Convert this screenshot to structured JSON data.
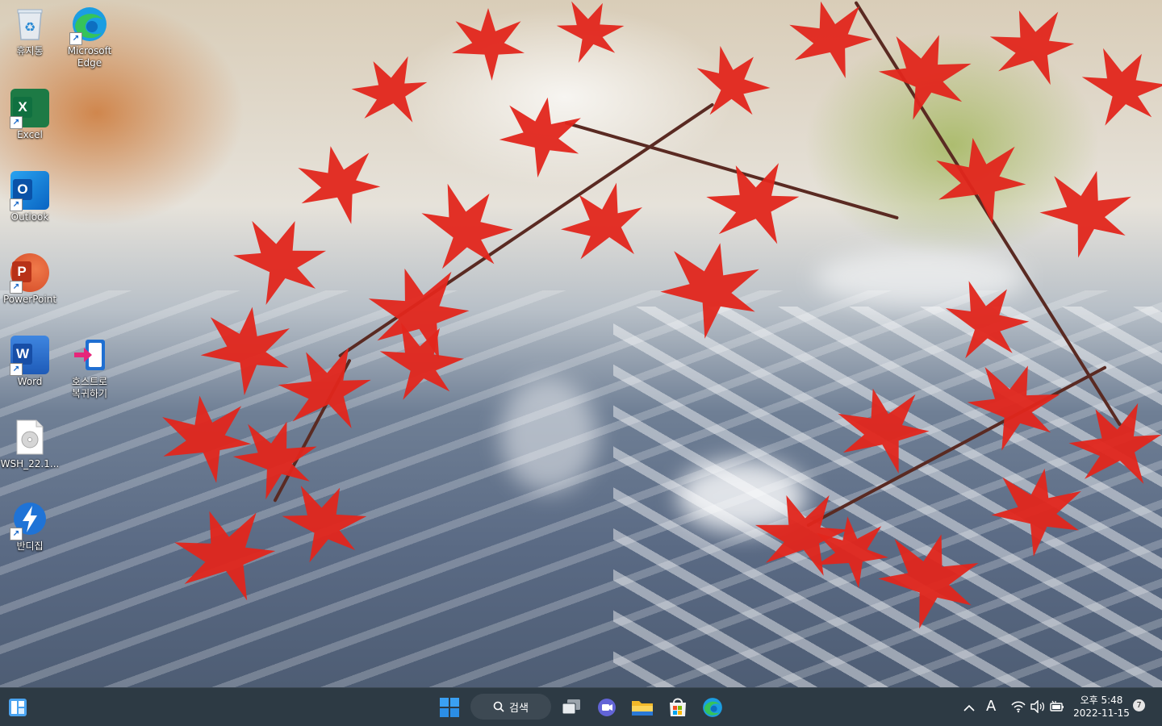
{
  "desktop": {
    "icons": [
      {
        "label": "휴지통",
        "icon": "recycle-bin-icon"
      },
      {
        "label": "Microsoft Edge",
        "icon": "edge-icon"
      },
      {
        "label": "Excel",
        "icon": "excel-icon",
        "letter": "X"
      },
      {
        "label": "Outlook",
        "icon": "outlook-icon",
        "letter": "O"
      },
      {
        "label": "PowerPoint",
        "icon": "powerpoint-icon",
        "letter": "P"
      },
      {
        "label": "Word",
        "icon": "word-icon",
        "letter": "W"
      },
      {
        "label": "호스트로 복귀하기",
        "icon": "return-to-host-icon"
      },
      {
        "label": "WSH_22.1...",
        "icon": "disc-image-file-icon"
      },
      {
        "label": "반디집",
        "icon": "bandizip-icon"
      }
    ],
    "edge_label_line1": "Microsoft",
    "edge_label_line2": "Edge",
    "host_label_line1": "호스트로",
    "host_label_line2": "복귀하기"
  },
  "taskbar": {
    "search_label": "검색",
    "tray": {
      "ime": "A",
      "time": "오후 5:48",
      "date": "2022-11-15",
      "notification_count": "7"
    }
  },
  "colors": {
    "taskbar_bg": "#2d3a44",
    "excel": "#1d7a45",
    "outlook": "#0a64c2",
    "powerpoint": "#d04423",
    "word": "#1e5bb8",
    "edge": "#1b9de2",
    "bandizip": "#1f73d6"
  }
}
